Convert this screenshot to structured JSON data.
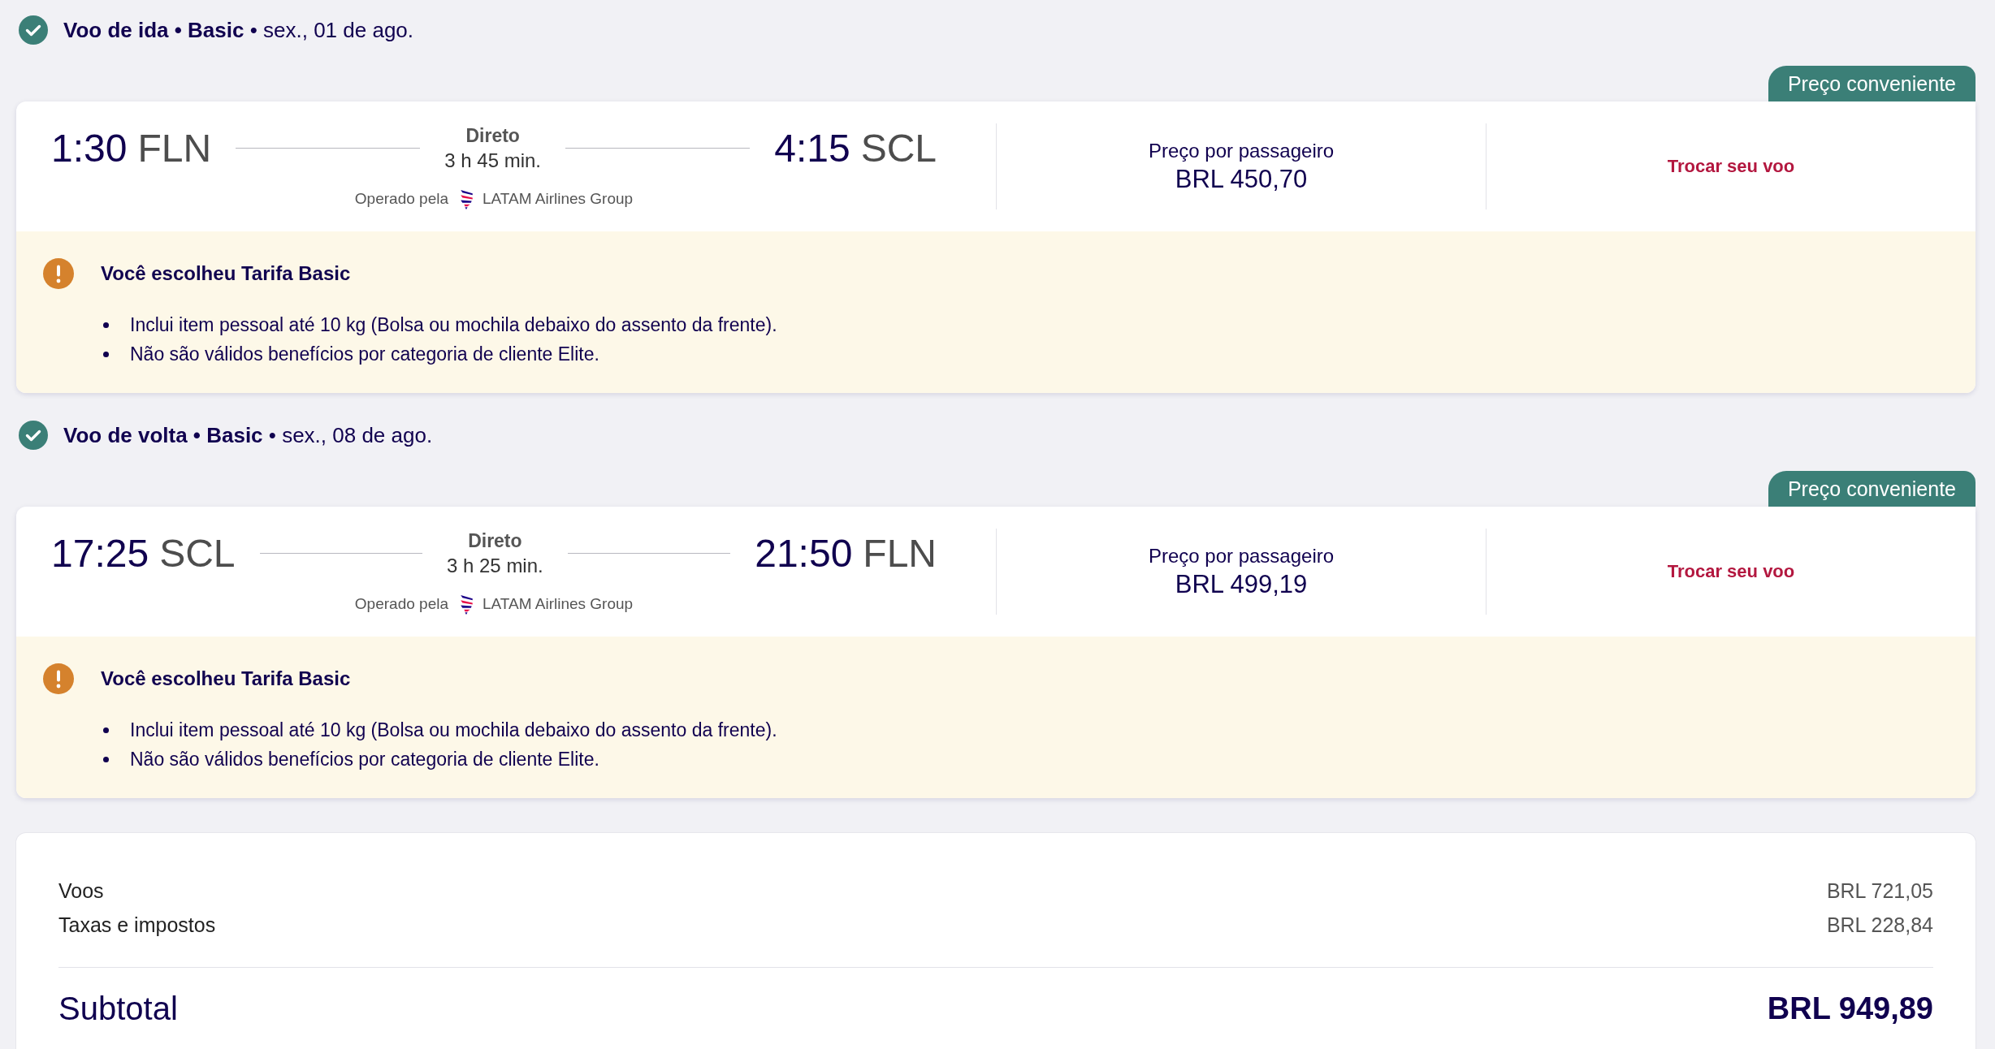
{
  "flights": [
    {
      "heading": "**Voo de ida • Basic** • sex., 01 de ago.",
      "badge": "Preço conveniente",
      "departure": {
        "time": "1:30",
        "airport": "FLN"
      },
      "stops": "Direto",
      "duration": "3 h 45 min.",
      "operator_label": "Operado pela",
      "operator": "LATAM Airlines Group",
      "arrival": {
        "time": "4:15",
        "airport": "SCL"
      },
      "price_label": "Preço por passageiro",
      "price": "BRL 450,70",
      "action": "Trocar seu voo",
      "notice": {
        "title": "Você escolheu Tarifa Basic",
        "items": [
          "Inclui item pessoal até 10 kg (Bolsa ou mochila debaixo do assento da frente).",
          "Não são válidos benefícios por categoria de cliente Elite."
        ]
      }
    },
    {
      "heading": "**Voo de volta • Basic** • sex., 08 de ago.",
      "badge": "Preço conveniente",
      "departure": {
        "time": "17:25",
        "airport": "SCL"
      },
      "stops": "Direto",
      "duration": "3 h 25 min.",
      "operator_label": "Operado pela",
      "operator": "LATAM Airlines Group",
      "arrival": {
        "time": "21:50",
        "airport": "FLN"
      },
      "price_label": "Preço por passageiro",
      "price": "BRL 499,19",
      "action": "Trocar seu voo",
      "notice": {
        "title": "Você escolheu Tarifa Basic",
        "items": [
          "Inclui item pessoal até 10 kg (Bolsa ou mochila debaixo do assento da frente).",
          "Não são válidos benefícios por categoria de cliente Elite."
        ]
      }
    }
  ],
  "summary": {
    "lines": [
      {
        "label": "Voos",
        "value": "BRL 721,05"
      },
      {
        "label": "Taxas e impostos",
        "value": "BRL 228,84"
      }
    ],
    "subtotal": {
      "label": "Subtotal",
      "value": "BRL 949,89"
    }
  }
}
